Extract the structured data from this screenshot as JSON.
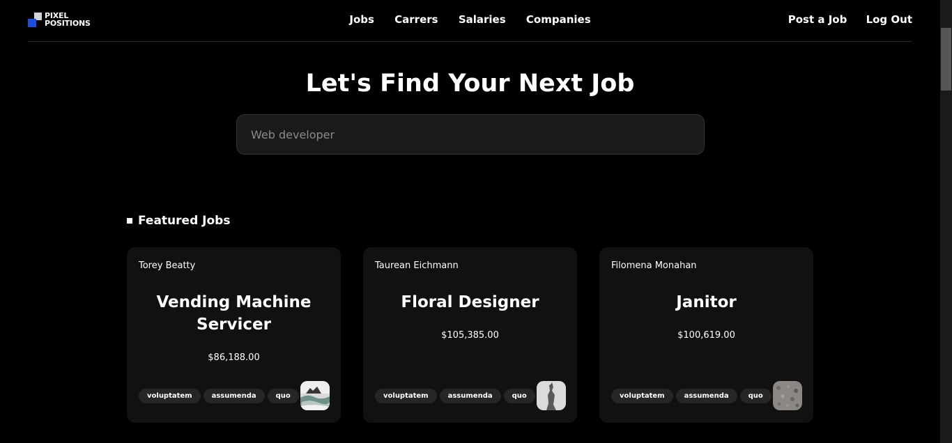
{
  "logo": {
    "line1": "PIXEL",
    "line2": "POSITIONS"
  },
  "nav": {
    "center": [
      "Jobs",
      "Carrers",
      "Salaries",
      "Companies"
    ],
    "right": [
      "Post a Job",
      "Log Out"
    ]
  },
  "hero": {
    "title": "Let's Find Your Next Job",
    "search_placeholder": "Web developer"
  },
  "featured": {
    "heading": "Featured Jobs",
    "jobs": [
      {
        "employer": "Torey Beatty",
        "title": "Vending Machine Servicer",
        "salary": "$86,188.00",
        "tags": [
          "voluptatem",
          "assumenda",
          "quo"
        ],
        "thumb_icon": "beach-rocks-image-icon"
      },
      {
        "employer": "Taurean Eichmann",
        "title": "Floral Designer",
        "salary": "$105,385.00",
        "tags": [
          "voluptatem",
          "assumenda",
          "quo"
        ],
        "thumb_icon": "statue-image-icon"
      },
      {
        "employer": "Filomena Monahan",
        "title": "Janitor",
        "salary": "$100,619.00",
        "tags": [
          "voluptatem",
          "assumenda",
          "quo"
        ],
        "thumb_icon": "pebbles-image-icon"
      }
    ]
  },
  "colors": {
    "background": "#000000",
    "card": "#111111",
    "tag": "#262626",
    "logo_blue": "#1d4ed8"
  }
}
